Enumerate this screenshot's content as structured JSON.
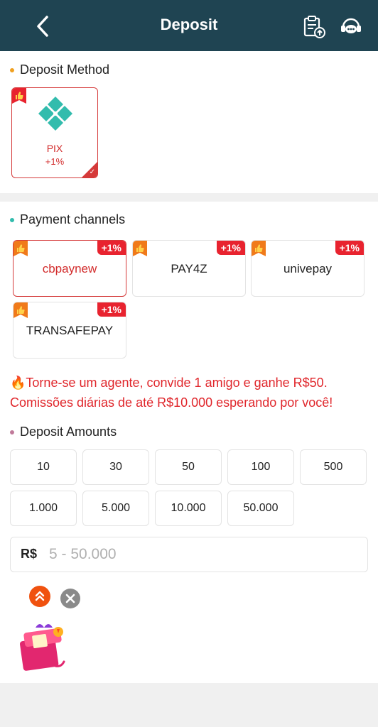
{
  "header": {
    "title": "Deposit"
  },
  "deposit_method": {
    "title": "Deposit Method",
    "methods": [
      {
        "name": "PIX",
        "bonus": "+1%",
        "selected": true
      }
    ]
  },
  "payment_channels": {
    "title": "Payment channels",
    "channels": [
      {
        "name": "cbpaynew",
        "bonus": "+1%",
        "selected": true
      },
      {
        "name": "PAY4Z",
        "bonus": "+1%",
        "selected": false
      },
      {
        "name": "univepay",
        "bonus": "+1%",
        "selected": false
      },
      {
        "name": "TRANSAFEPAY",
        "bonus": "+1%",
        "selected": false
      }
    ]
  },
  "promo": {
    "line1": "Torne-se um agente, convide 1 amigo e ganhe R$50.",
    "line2": "Comissões diárias de até R$10.000 esperando por você!"
  },
  "deposit_amounts": {
    "title": "Deposit Amounts",
    "amounts": [
      "10",
      "30",
      "50",
      "100",
      "500",
      "1.000",
      "5.000",
      "10.000",
      "50.000"
    ],
    "currency": "R$",
    "placeholder": "5 - 50.000"
  },
  "colors": {
    "header_bg": "#1f4452",
    "accent_red": "#d53a3a",
    "promo_red": "#e0262b",
    "pix_teal": "#32bcad"
  }
}
